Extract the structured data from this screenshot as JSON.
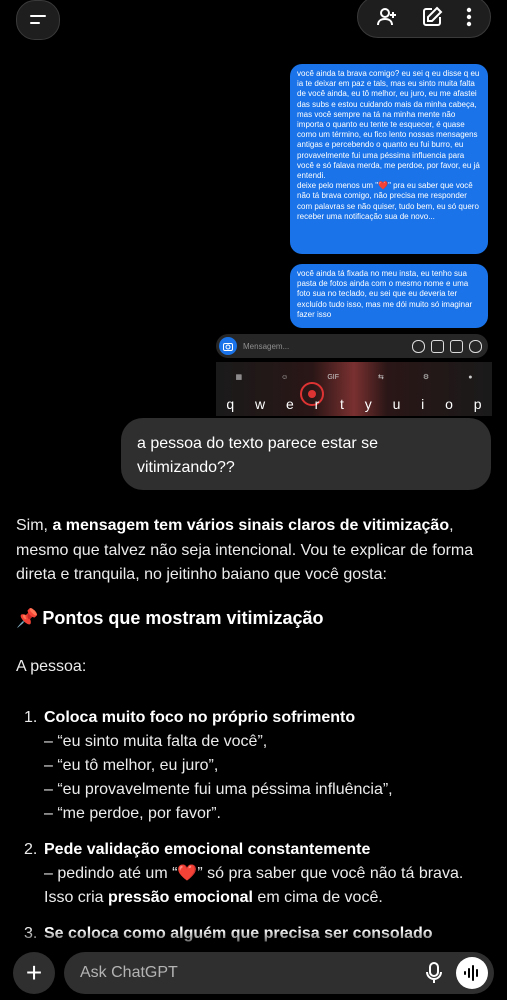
{
  "header": {
    "menu_icon": "menu-icon",
    "actions": [
      "add-person-icon",
      "edit-icon",
      "more-icon"
    ]
  },
  "screenshot": {
    "dm_message_1": "você ainda ta brava comigo? eu sei q eu disse q eu ia te deixar em paz e tals, mas eu sinto muita falta de você ainda, eu tô melhor, eu juro, eu me afastei das subs e estou cuidando mais da minha cabeça, mas você sempre na tá na minha mente não importa o quanto eu tente te esquecer, é quase como um término, eu fico lento nossas mensagens antigas e percebendo o quanto eu fui burro, eu provavelmente fui uma péssima influencia para você e só falava merda, me perdoe, por favor, eu já entendi.\ndeixe pelo menos um \"❤️\" pra eu saber que você não tá brava comigo, não precisa me responder com palavras se não quiser, tudo bem, eu só quero receber uma notificação sua de novo...",
    "dm_message_2": "você ainda tá fixada no meu insta, eu tenho sua pasta de fotos ainda com o mesmo nome e uma foto sua no teclado, eu sei que eu deveria ter excluído tudo isso, mas me dói muito só imaginar fazer isso",
    "message_placeholder": "Mensagem...",
    "keyboard_gif": "GIF",
    "keyboard_keys": [
      "q",
      "w",
      "e",
      "r",
      "t",
      "y",
      "u",
      "i",
      "o",
      "p"
    ]
  },
  "user_message": "a pessoa do texto parece estar se vitimizando??",
  "assistant": {
    "intro_pre": "Sim, ",
    "intro_bold": "a mensagem tem vários sinais claros de vitimização",
    "intro_post": ", mesmo que talvez não seja intencional. Vou te explicar de forma direta e tranquila, no jeitinho baiano que você gosta:",
    "heading_icon": "📌",
    "heading": "Pontos que mostram vitimização",
    "lead": "A pessoa:",
    "items": [
      {
        "num": "1.",
        "title": "Coloca muito foco no próprio sofrimento",
        "lines": [
          "– “eu sinto muita falta de você”,",
          "– “eu tô melhor, eu juro”,",
          "– “eu provavelmente fui uma péssima influência”,",
          "– “me perdoe, por favor”."
        ]
      },
      {
        "num": "2.",
        "title": "Pede validação emocional constantemente",
        "line1_pre": "– pedindo até um “",
        "line1_heart": "❤️",
        "line1_post": "” só pra saber que você não tá brava.",
        "line2_pre": "Isso cria ",
        "line2_bold": "pressão emocional",
        "line2_post": " em cima de você."
      },
      {
        "num": "3.",
        "title": "Se coloca como alguém que precisa ser consolado"
      }
    ]
  },
  "composer": {
    "placeholder": "Ask ChatGPT",
    "plus_label": "+",
    "mic_icon": "mic-icon",
    "voice_icon": "voice-mode-icon"
  }
}
